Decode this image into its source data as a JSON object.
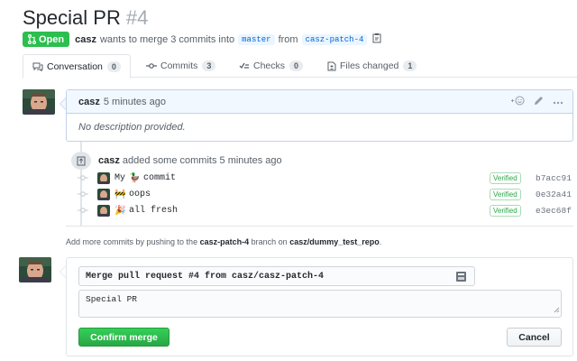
{
  "pr": {
    "title": "Special PR",
    "number": "#4",
    "state": "Open",
    "author": "casz",
    "merge_text": "wants to merge 3 commits into",
    "base_branch": "master",
    "from_text": "from",
    "head_branch": "casz-patch-4"
  },
  "tabs": [
    {
      "label": "Conversation",
      "count": "0"
    },
    {
      "label": "Commits",
      "count": "3"
    },
    {
      "label": "Checks",
      "count": "0"
    },
    {
      "label": "Files changed",
      "count": "1"
    }
  ],
  "comment": {
    "author": "casz",
    "time": "5 minutes ago",
    "body": "No description provided."
  },
  "push_event": {
    "author": "casz",
    "text": "added some commits 5 minutes ago"
  },
  "commits": [
    {
      "emoji": "🦆",
      "message_pre": "My",
      "message": "commit",
      "verified": "Verified",
      "sha": "b7acc91"
    },
    {
      "emoji": "🚧",
      "message_pre": "",
      "message": "oops",
      "verified": "Verified",
      "sha": "0e32a41"
    },
    {
      "emoji": "🎉",
      "message_pre": "",
      "message": "all fresh",
      "verified": "Verified",
      "sha": "e3ec68f"
    }
  ],
  "hint": {
    "pre": "Add more commits by pushing to the",
    "branch": "casz-patch-4",
    "mid": "branch on",
    "repo": "casz/dummy_test_repo",
    "post": "."
  },
  "merge": {
    "title_value": "Merge pull request #4 from casz/casz-patch-4",
    "message_value": "Special PR",
    "confirm_label": "Confirm merge",
    "cancel_label": "Cancel"
  },
  "colors": {
    "open_green": "#2cbe4e",
    "confirm_green": "#28a745",
    "link_blue": "#0366d6",
    "comment_header": "#f1f8ff"
  }
}
